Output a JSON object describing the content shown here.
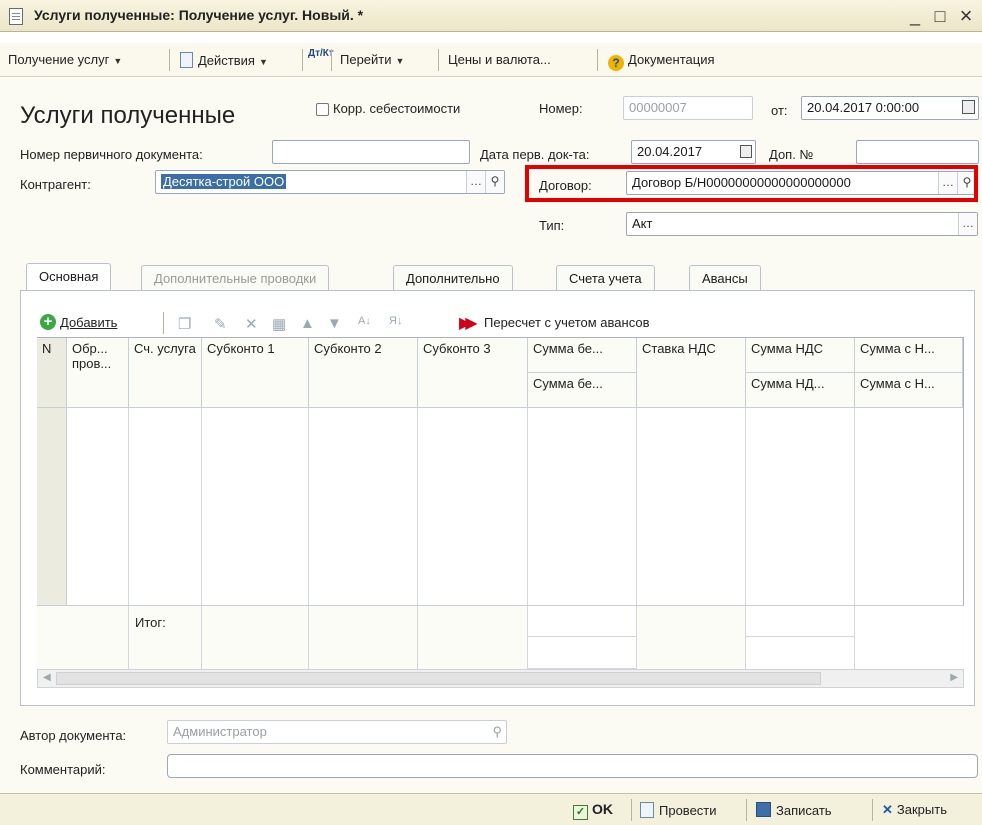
{
  "window": {
    "title": "Услуги полученные: Получение услуг. Новый. *",
    "minimize": "_",
    "maximize": "□",
    "close": "×"
  },
  "toolbar": {
    "receive_services": "Получение услуг",
    "actions": "Действия",
    "dt_kt": "Дт/Кт",
    "goto": "Перейти",
    "prices_currency": "Цены и валюта...",
    "documentation": "Документация"
  },
  "header": {
    "form_title": "Услуги полученные",
    "corr_cost_label": "Корр. себестоимости",
    "number_label": "Номер:",
    "number_value": "00000007",
    "date_label": "от:",
    "date_value": "20.04.2017  0:00:00",
    "primary_doc_number_label": "Номер первичного документа:",
    "primary_doc_number_value": "",
    "primary_doc_date_label": "Дата перв. док-та:",
    "primary_doc_date_value": "20.04.2017",
    "extra_no_label": "Доп. №",
    "extra_no_value": "",
    "counterparty_label": "Контрагент:",
    "counterparty_value": "Десятка-строй ООО",
    "contract_label": "Договор:",
    "contract_value": "Договор  Б/Н00000000000000000000",
    "type_label": "Тип:",
    "type_value": "Акт"
  },
  "tabs": [
    {
      "label": "Основная"
    },
    {
      "label": "Дополнительные проводки"
    },
    {
      "label": "Дополнительно"
    },
    {
      "label": "Счета учета"
    },
    {
      "label": "Авансы"
    }
  ],
  "table_toolbar": {
    "add": "Добавить",
    "recalc": "Пересчет с учетом авансов"
  },
  "table": {
    "col_n": "N",
    "col_posting": "Обр... пров...",
    "col_account": "Сч. услуга",
    "col_sub1": "Субконто 1",
    "col_sub2": "Субконто 2",
    "col_sub3": "Субконто 3",
    "col_sum_wo_1": "Сумма бе...",
    "col_sum_wo_2": "Сумма бе...",
    "col_vat_rate": "Ставка НДС",
    "col_vat_1": "Сумма НДС",
    "col_vat_2": "Сумма НД...",
    "col_total_1": "Сумма с Н...",
    "col_total_2": "Сумма с Н...",
    "footer_total": "Итог:"
  },
  "footer": {
    "author_label": "Автор документа:",
    "author_value": "Администратор",
    "comment_label": "Комментарий:",
    "comment_value": ""
  },
  "bottom_bar": {
    "ok": "OK",
    "post": "Провести",
    "save": "Записать",
    "close": "Закрыть"
  }
}
